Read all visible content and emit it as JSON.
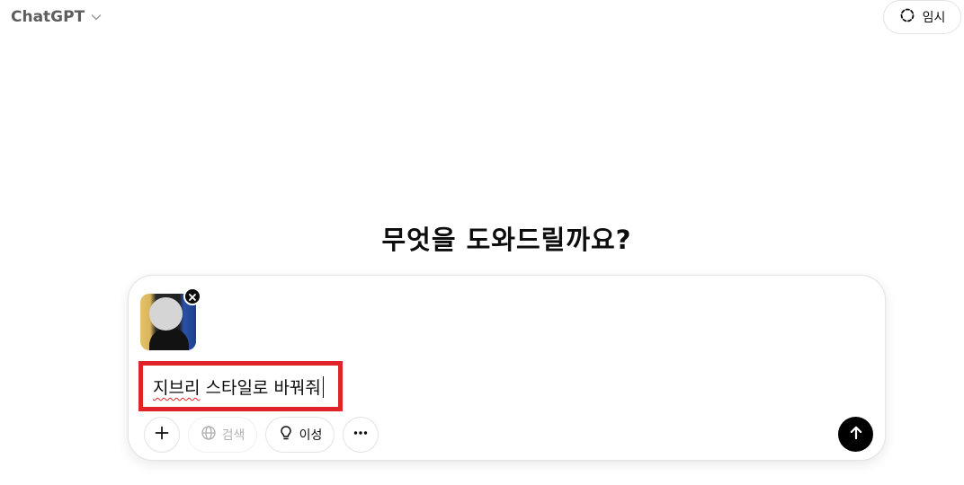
{
  "header": {
    "model_name": "ChatGPT",
    "model_switcher_icon": "chevron-down-icon",
    "temporary_chat_label": "임시",
    "temporary_chat_icon": "dashed-circle-icon"
  },
  "main": {
    "headline": "무엇을 도와드릴까요?"
  },
  "composer": {
    "attachment": {
      "kind": "image-thumbnail",
      "remove_icon": "close-icon"
    },
    "input_value_misspelled_part": "지브리",
    "input_value_rest": " 스타일로 바꿔줘",
    "highlight_color": "#e0242a",
    "buttons": {
      "attach_icon": "plus-icon",
      "search_label": "검색",
      "search_icon": "globe-icon",
      "reason_label": "이성",
      "reason_icon": "lightbulb-icon",
      "more_icon": "ellipsis-icon",
      "send_icon": "arrow-up-icon"
    }
  }
}
